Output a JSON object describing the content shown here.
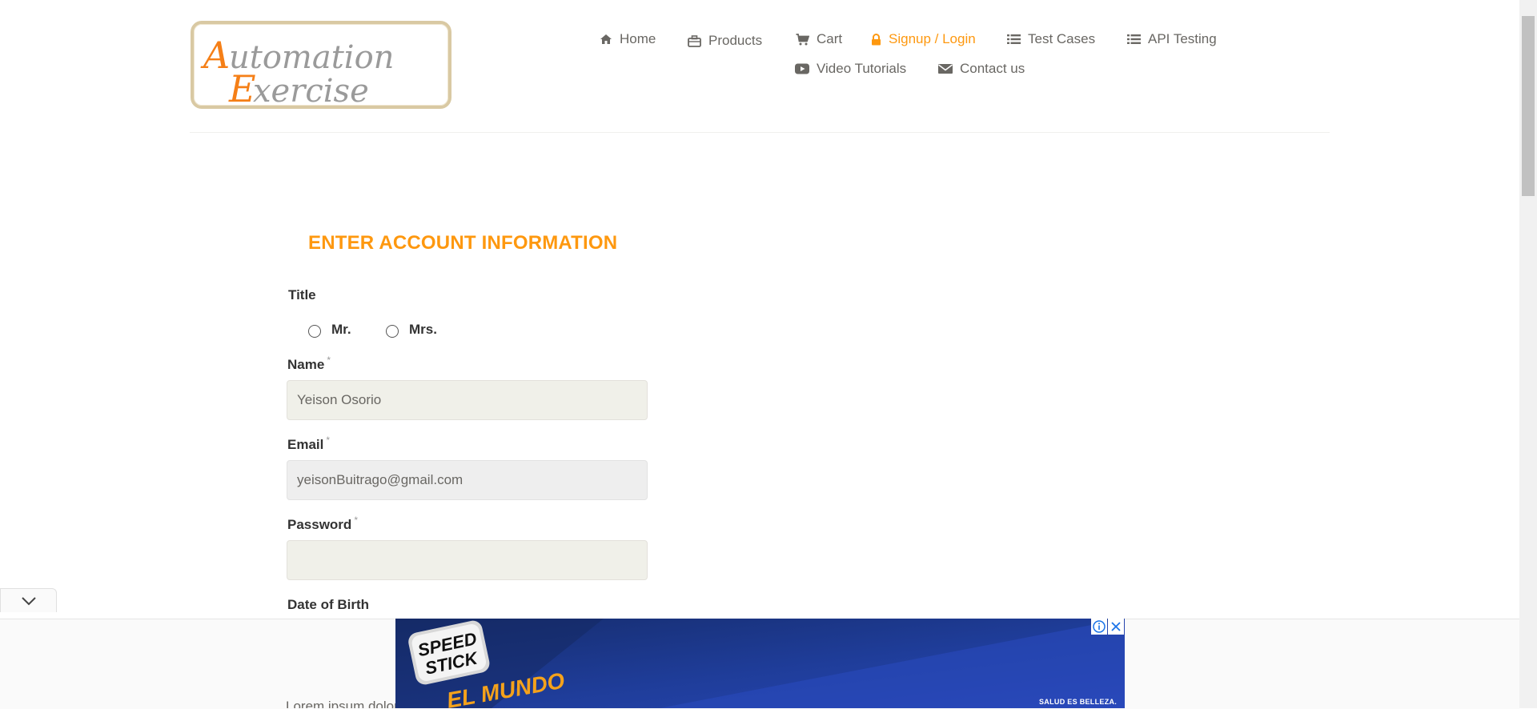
{
  "brand": {
    "logo_text_line1": "Automation",
    "logo_text_line2": "Exercise"
  },
  "nav": {
    "items": [
      {
        "label": "Home",
        "icon": "home-icon",
        "active": false
      },
      {
        "label": "Products",
        "icon": "briefcase-icon",
        "active": false
      },
      {
        "label": "Cart",
        "icon": "cart-icon",
        "active": false
      },
      {
        "label": "Signup / Login",
        "icon": "lock-icon",
        "active": true
      },
      {
        "label": "Test Cases",
        "icon": "list-icon",
        "active": false
      },
      {
        "label": "API Testing",
        "icon": "list-icon",
        "active": false
      },
      {
        "label": "Video Tutorials",
        "icon": "youtube-play-icon",
        "active": false
      },
      {
        "label": "Contact us",
        "icon": "envelope-icon",
        "active": false
      }
    ]
  },
  "form": {
    "title": "ENTER ACCOUNT INFORMATION",
    "title_label": "Title",
    "title_options": [
      {
        "label": "Mr.",
        "checked": false
      },
      {
        "label": "Mrs.",
        "checked": false
      }
    ],
    "name_label": "Name",
    "name_value": "Yeison Osorio",
    "email_label": "Email",
    "email_value": "yeisonBuitrago@gmail.com",
    "password_label": "Password",
    "password_value": "",
    "required_mark": "*",
    "dob_label": "Date of Birth"
  },
  "ad": {
    "brand": "SPEED STICK",
    "headline": "EL MUNDO",
    "tagline": "SALUD ES BELLEZA.",
    "partial_text": "Lorem ipsum dolor sit"
  },
  "colors": {
    "accent": "#fe980f",
    "text": "#696763",
    "ad_blue": "#1f3d9a"
  }
}
